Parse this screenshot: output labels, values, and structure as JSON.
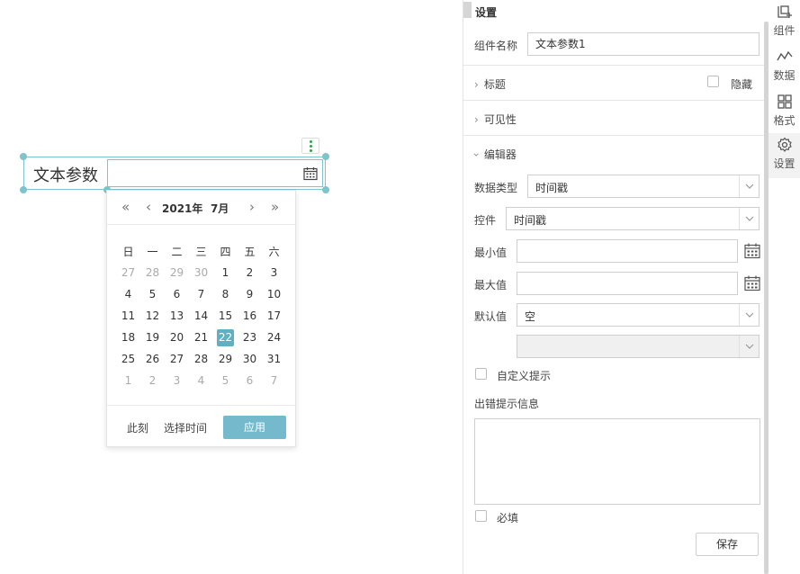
{
  "widget": {
    "label": "文本参数"
  },
  "picker": {
    "nav_prev_year": "«",
    "nav_prev_month": "‹",
    "year": "2021年",
    "month": "7月",
    "nav_next_month": "›",
    "nav_next_year": "»",
    "weekdays": [
      "日",
      "一",
      "二",
      "三",
      "四",
      "五",
      "六"
    ],
    "days": [
      [
        "27",
        "28",
        "29",
        "30",
        "1",
        "2",
        "3"
      ],
      [
        "4",
        "5",
        "6",
        "7",
        "8",
        "9",
        "10"
      ],
      [
        "11",
        "12",
        "13",
        "14",
        "15",
        "16",
        "17"
      ],
      [
        "18",
        "19",
        "20",
        "21",
        "22",
        "23",
        "24"
      ],
      [
        "25",
        "26",
        "27",
        "28",
        "29",
        "30",
        "31"
      ],
      [
        "1",
        "2",
        "3",
        "4",
        "5",
        "6",
        "7"
      ]
    ],
    "selected_day": "22",
    "now_label": "此刻",
    "choose_time_label": "选择时间",
    "apply_label": "应用"
  },
  "panel": {
    "title": "设置",
    "component_name_label": "组件名称",
    "component_name_value": "文本参数1",
    "section_title": "标题",
    "hide_label": "隐藏",
    "section_visibility": "可见性",
    "section_editor": "编辑器",
    "data_type_label": "数据类型",
    "data_type_value": "时间戳",
    "control_label": "控件",
    "control_value": "时间戳",
    "min_label": "最小值",
    "max_label": "最大值",
    "default_label": "默认值",
    "default_value": "空",
    "custom_hint_label": "自定义提示",
    "error_hint_label": "出错提示信息",
    "required_label": "必填",
    "save_label": "保存"
  },
  "tabs": [
    {
      "label": "组件",
      "icon": "component-icon"
    },
    {
      "label": "数据",
      "icon": "data-icon"
    },
    {
      "label": "格式",
      "icon": "format-icon"
    },
    {
      "label": "设置",
      "icon": "gear-icon"
    }
  ],
  "colors": {
    "accent": "#5fb0c2",
    "apply_button": "#74b9cc",
    "selection_border": "#7fc3cc",
    "more_dots": "#27a745"
  }
}
